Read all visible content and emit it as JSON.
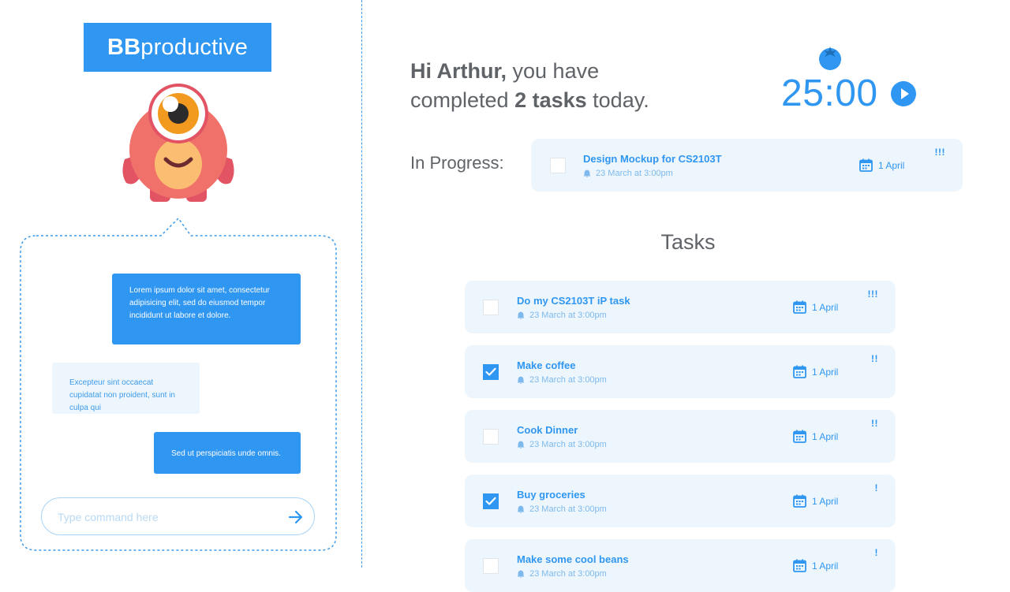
{
  "app": {
    "logo_bold": "BB",
    "logo_rest": "productive"
  },
  "chat": {
    "messages": [
      {
        "from": "bot",
        "text": "Lorem ipsum dolor sit amet, consectetur adipisicing elit, sed do eiusmod tempor incididunt ut labore et dolore."
      },
      {
        "from": "user",
        "text": "Excepteur sint occaecat cupidatat non proident, sunt in culpa qui"
      },
      {
        "from": "bot",
        "text": "Sed ut perspiciatis unde omnis."
      }
    ],
    "input_placeholder": "Type command here"
  },
  "greeting": {
    "hi": "Hi Arthur,",
    "rest1": " you have",
    "rest2": "completed ",
    "count": "2 tasks",
    "rest3": " today."
  },
  "timer": {
    "display": "25:00"
  },
  "in_progress": {
    "label": "In Progress:",
    "task": {
      "title": "Design Mockup for CS2103T",
      "reminder": "23 March at 3:00pm",
      "due": "1 April",
      "priority": "!!!",
      "checked": false
    }
  },
  "tasks": {
    "heading": "Tasks",
    "items": [
      {
        "title": "Do my CS2103T iP task",
        "reminder": "23 March at 3:00pm",
        "due": "1 April",
        "priority": "!!!",
        "checked": false
      },
      {
        "title": "Make coffee",
        "reminder": "23 March at 3:00pm",
        "due": "1 April",
        "priority": "!!",
        "checked": true
      },
      {
        "title": "Cook Dinner",
        "reminder": "23 March at 3:00pm",
        "due": "1 April",
        "priority": "!!",
        "checked": false
      },
      {
        "title": "Buy groceries",
        "reminder": "23 March at 3:00pm",
        "due": "1 April",
        "priority": "!",
        "checked": true
      },
      {
        "title": "Make some cool beans",
        "reminder": "23 March at 3:00pm",
        "due": "1 April",
        "priority": "!",
        "checked": false
      }
    ]
  },
  "colors": {
    "accent": "#2f96f1",
    "card_bg": "#eef6fd",
    "text_gray": "#5f6368",
    "mascot_body": "#f0706a",
    "mascot_eye": "#f29a1f"
  },
  "icons": {
    "send": "arrow-right-icon",
    "timer": "tomato-icon",
    "play": "play-icon",
    "reminder": "bell-icon",
    "due": "calendar-icon",
    "check": "check-icon"
  }
}
